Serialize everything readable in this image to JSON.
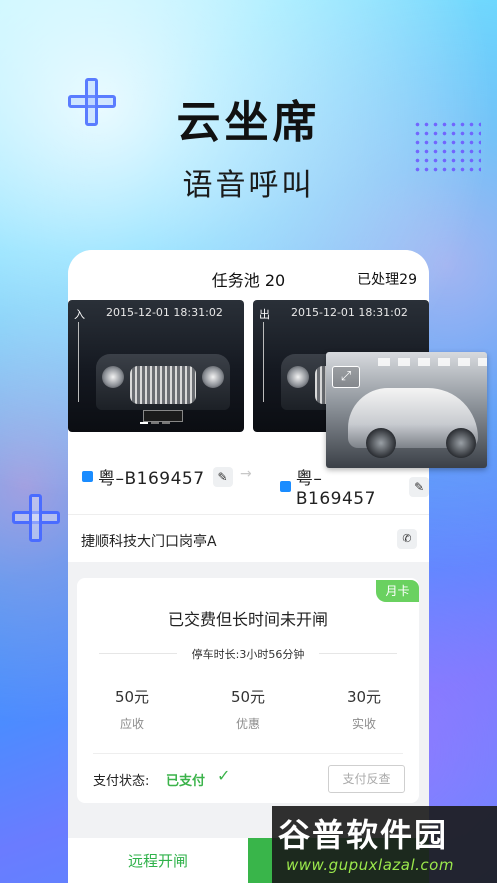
{
  "promo": {
    "title": "云坐席",
    "subtitle": "语音呼叫"
  },
  "header": {
    "title": "任务池 20",
    "processed": "已处理29"
  },
  "photos": [
    {
      "direction": "入",
      "timestamp": "2015-12-01 18:31:02"
    },
    {
      "direction": "出",
      "timestamp": "2015-12-01 18:31:02"
    }
  ],
  "plates": {
    "entry": "粤–B169457",
    "exit": "粤–B169457",
    "accent": "#1a8cff"
  },
  "location": {
    "name": "捷顺科技大门口岗亭A"
  },
  "card": {
    "badge": "月卡",
    "title": "已交费但长时间未开闸",
    "duration": "停车时长:3小时56分钟",
    "amounts": [
      {
        "value": "50元",
        "label": "应收"
      },
      {
        "value": "50元",
        "label": "优惠"
      },
      {
        "value": "30元",
        "label": "实收"
      }
    ],
    "pay_status_label": "支付状态:",
    "pay_status_value": "已支付",
    "refund_label": "支付反查",
    "success_color": "#3bb34a"
  },
  "actions": {
    "remote_open": "远程开闸"
  },
  "watermark": {
    "title": "谷普软件园",
    "url": "www.gupuxlazal.com"
  },
  "icons": [
    "plus-icon",
    "pencil-icon",
    "arrow-right-icon",
    "phone-icon",
    "check-icon",
    "expand-icon"
  ]
}
